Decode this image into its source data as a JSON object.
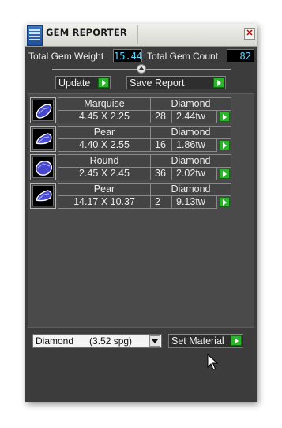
{
  "window": {
    "title": "GEM REPORTER",
    "close_glyph": "✕"
  },
  "stats": {
    "weight_label": "Total Gem Weight",
    "weight_value": "15.44",
    "count_label": "Total Gem Count",
    "count_value": "82",
    "value_color": "#5fd7ff"
  },
  "actions": {
    "update_label": "Update",
    "save_label": "Save Report",
    "arrow_icon": "green-play-arrow-icon",
    "arrow_color": "#2bb52b"
  },
  "gems": [
    {
      "shape": "Marquise",
      "dimensions": "4.45 X 2.25",
      "material": "Diamond",
      "count": "28",
      "weight": "2.44tw",
      "icon": "gem-thumbnail-icon"
    },
    {
      "shape": "Pear",
      "dimensions": "4.40 X 2.55",
      "material": "Diamond",
      "count": "16",
      "weight": "1.86tw",
      "icon": "gem-thumbnail-icon"
    },
    {
      "shape": "Round",
      "dimensions": "2.45 X 2.45",
      "material": "Diamond",
      "count": "36",
      "weight": "2.02tw",
      "icon": "gem-thumbnail-icon"
    },
    {
      "shape": "Pear",
      "dimensions": "14.17 X 10.37",
      "material": "Diamond",
      "count": "2",
      "weight": "9.13tw",
      "icon": "gem-thumbnail-icon"
    }
  ],
  "material": {
    "selected": "Diamond      (3.52 spg)",
    "set_label": "Set Material"
  }
}
